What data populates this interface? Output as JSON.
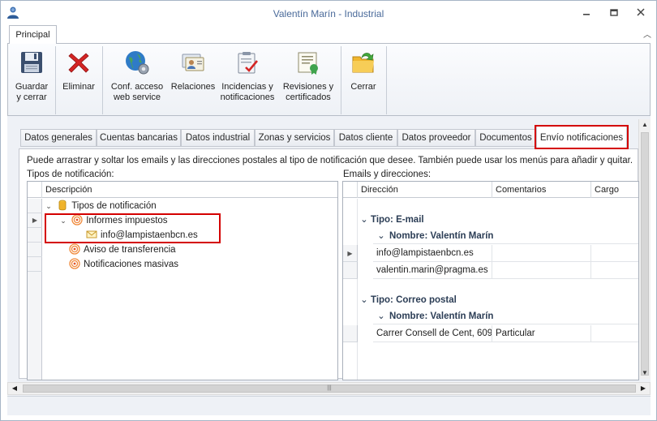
{
  "window": {
    "title": "Valentín Marín - Industrial"
  },
  "ribbon": {
    "tab": "Principal",
    "buttons": [
      {
        "label": "Guardar\ny cerrar",
        "icon": "floppy-disk-icon"
      },
      {
        "label": "Eliminar",
        "icon": "red-x-icon"
      },
      {
        "label": "Conf. acceso\nweb service",
        "icon": "globe-gear-icon"
      },
      {
        "label": "Relaciones",
        "icon": "contact-cards-icon"
      },
      {
        "label": "Incidencias y\nnotificaciones",
        "icon": "clipboard-check-icon"
      },
      {
        "label": "Revisiones y\ncertificados",
        "icon": "certificate-icon"
      },
      {
        "label": "Cerrar",
        "icon": "folder-arrow-icon"
      }
    ]
  },
  "tabs": [
    "Datos generales",
    "Cuentas bancarias",
    "Datos industrial",
    "Zonas y servicios",
    "Datos cliente",
    "Datos proveedor",
    "Documentos",
    "Envío notificaciones"
  ],
  "active_tab": "Envío notificaciones",
  "instructions": "Puede arrastrar y soltar los emails y las direcciones postales al tipo de notificación que desee. También puede usar los menús para añadir y quitar.",
  "left": {
    "label": "Tipos de notificación:",
    "column": "Descripción",
    "root": "Tipos de notificación",
    "items": [
      "Informes impuestos",
      "info@lampistaenbcn.es",
      "Aviso de transferencia",
      "Notificaciones masivas"
    ]
  },
  "right": {
    "label": "Emails y direcciones:",
    "columns": [
      "Dirección",
      "Comentarios",
      "Cargo"
    ],
    "group1": "Tipo: E-mail",
    "sub1": "Nombre: Valentín Marín",
    "rows1": [
      "info@lampistaenbcn.es",
      "valentin.marin@pragma.es"
    ],
    "group2": "Tipo: Correo postal",
    "sub2": "Nombre: Valentín Marín",
    "row2": {
      "address": "Carrer Consell de Cent, 609",
      "comment": "Particular"
    }
  },
  "colors": {
    "highlight": "#d40000",
    "title_text": "#4a6a9a"
  }
}
